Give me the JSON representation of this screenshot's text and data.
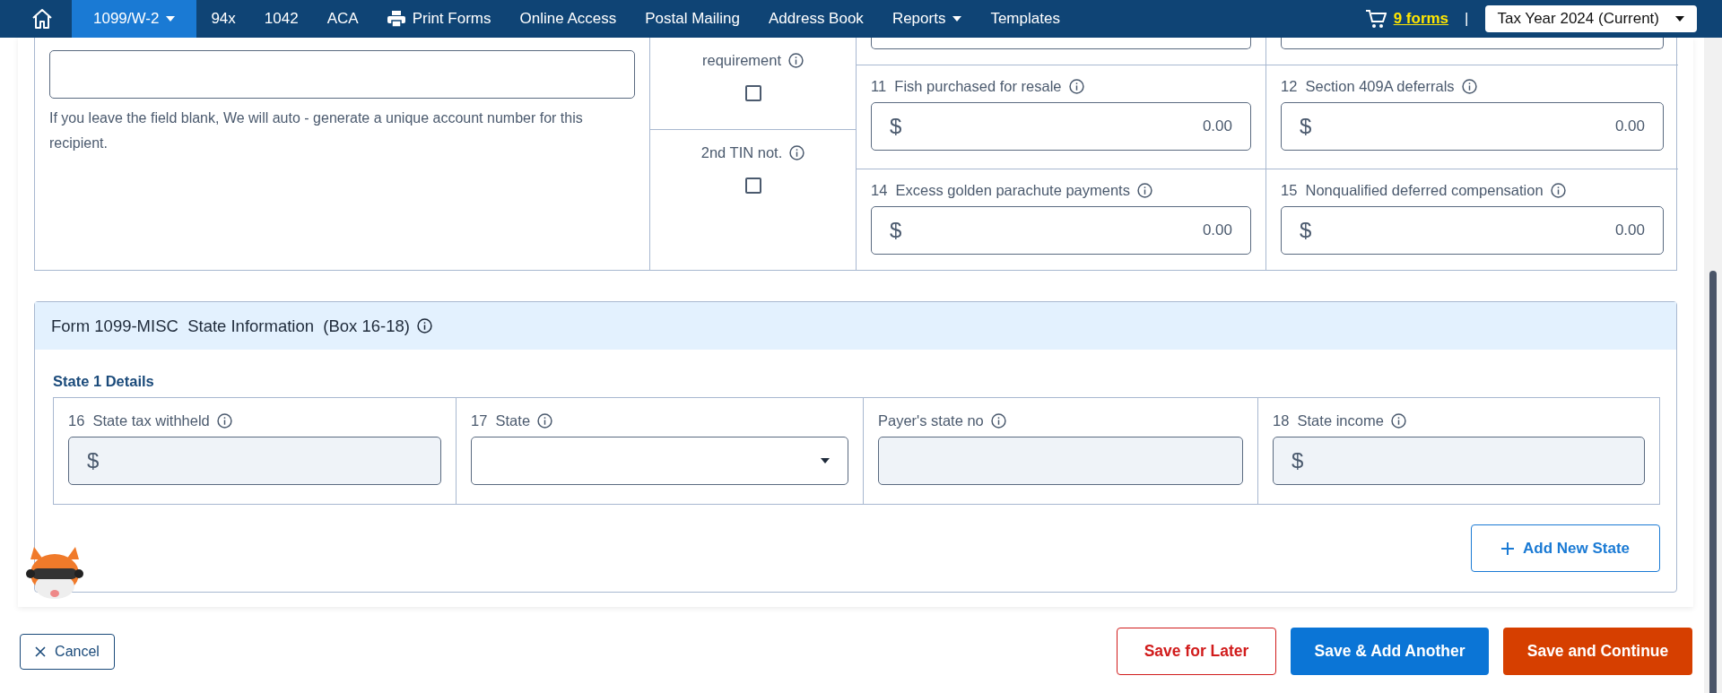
{
  "nav": {
    "items": [
      {
        "label": "1099/W-2",
        "kind": "menu",
        "selected": true
      },
      {
        "label": "94x",
        "kind": "link",
        "selected": false
      },
      {
        "label": "1042",
        "kind": "link",
        "selected": false
      },
      {
        "label": "ACA",
        "kind": "link",
        "selected": false
      },
      {
        "label": "Print Forms",
        "kind": "print",
        "selected": false
      },
      {
        "label": "Online Access",
        "kind": "link",
        "selected": false
      },
      {
        "label": "Postal Mailing",
        "kind": "link",
        "selected": false
      },
      {
        "label": "Address Book",
        "kind": "link",
        "selected": false
      },
      {
        "label": "Reports",
        "kind": "menu",
        "selected": false
      },
      {
        "label": "Templates",
        "kind": "link",
        "selected": false
      }
    ],
    "cart": "9 forms",
    "separator": "|",
    "tax_year": "Tax Year 2024 (Current)"
  },
  "upper_form": {
    "account_help": "If you leave the field blank, We will auto - generate a unique account number for this recipient.",
    "checkboxes": [
      {
        "label": "requirement",
        "checked": false
      },
      {
        "label": "2nd TIN not.",
        "checked": false
      }
    ],
    "boxes": [
      {
        "number": "11",
        "label": "Fish purchased for resale",
        "currency": "$",
        "value": "0.00"
      },
      {
        "number": "12",
        "label": "Section 409A deferrals",
        "currency": "$",
        "value": "0.00"
      },
      {
        "number": "14",
        "label": "Excess golden parachute payments",
        "currency": "$",
        "value": "0.00"
      },
      {
        "number": "15",
        "label": "Nonqualified deferred compensation",
        "currency": "$",
        "value": "0.00"
      }
    ]
  },
  "state_section": {
    "title": "Form 1099-MISC  State Information  (Box 16-18)",
    "subtitle": "State 1 Details",
    "fields": [
      {
        "kind": "money",
        "number": "16",
        "label": "State tax withheld",
        "currency": "$"
      },
      {
        "kind": "select",
        "number": "17",
        "label": "State"
      },
      {
        "kind": "text",
        "label": "Payer's state no"
      },
      {
        "kind": "money",
        "number": "18",
        "label": "State income",
        "currency": "$"
      }
    ],
    "add_button": "Add New State"
  },
  "footer": {
    "cancel": "Cancel",
    "buttons": [
      {
        "label": "Save for Later",
        "kind": "outline"
      },
      {
        "label": "Save & Add Another",
        "kind": "primary"
      },
      {
        "label": "Save and Continue",
        "kind": "accent"
      }
    ]
  }
}
